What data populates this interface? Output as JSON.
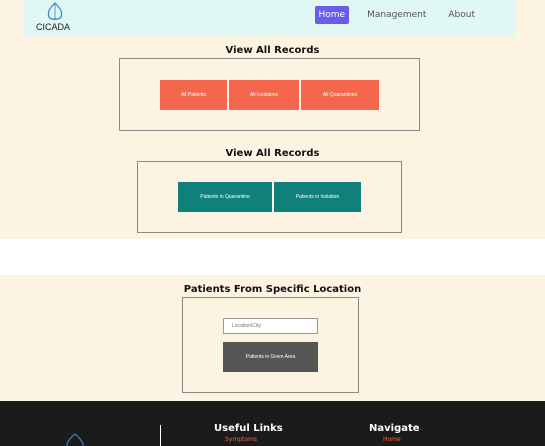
{
  "header": {
    "logo_text": "CICADA",
    "nav": [
      {
        "label": "Home",
        "active": true
      },
      {
        "label": "Management",
        "active": false
      },
      {
        "label": "About",
        "active": false
      }
    ]
  },
  "records_section": {
    "title": "View All Records",
    "buttons": [
      "All Patients",
      "All Isolations",
      "All Quarantines"
    ]
  },
  "records_section_2": {
    "title": "View All Records",
    "buttons": [
      "Patients in Quarantine",
      "Patients in Isolation"
    ]
  },
  "location_section": {
    "title": "Patients From Specific Location",
    "input_placeholder": "Location/City",
    "button_label": "Patients in Given Area"
  },
  "footer": {
    "useful_links": {
      "heading": "Useful Links",
      "first_link": "Symptoms"
    },
    "navigate": {
      "heading": "Navigate",
      "first_link": "Home"
    }
  },
  "colors": {
    "accent": "#6b5ce7",
    "orange_button": "#f4674c",
    "teal_button": "#0f807a",
    "dark_button": "#555555",
    "background": "#fdf3e2",
    "navbar": "#dff7f5",
    "footer": "#1b1b1b"
  },
  "icons": [
    "cicada-logo-icon",
    "footer-logo-icon"
  ]
}
